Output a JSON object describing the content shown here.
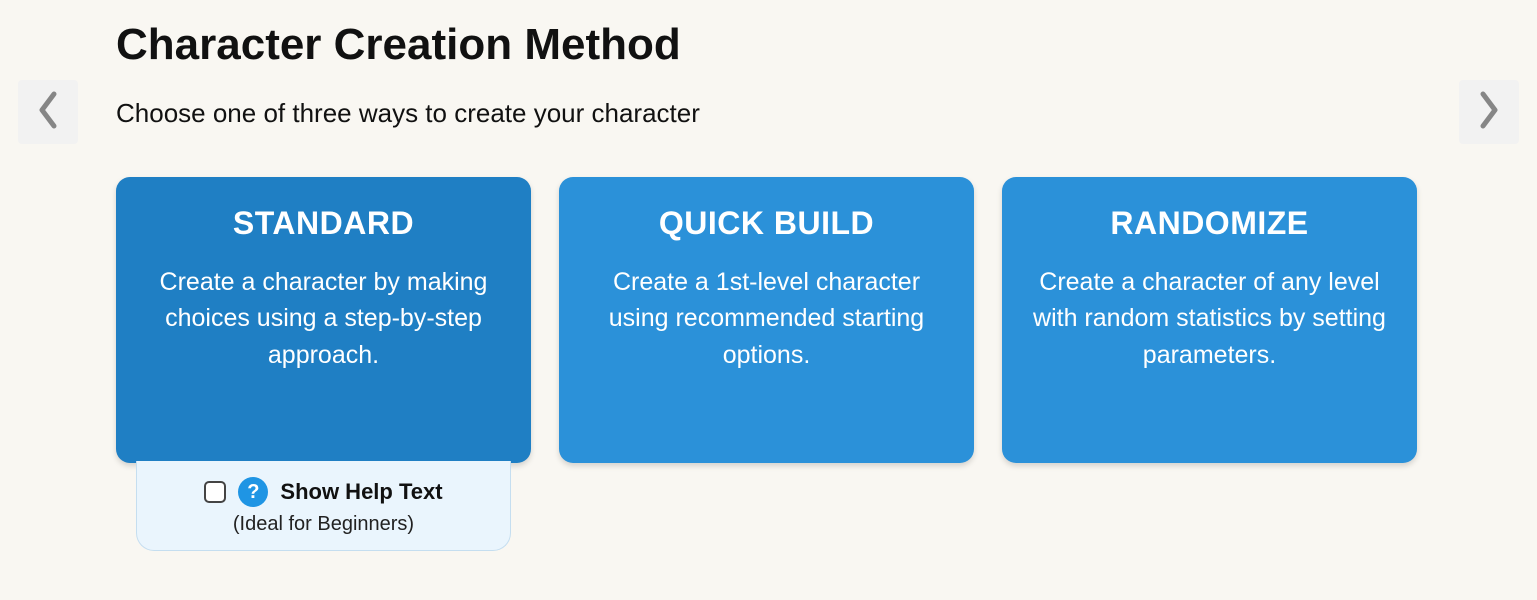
{
  "page": {
    "title": "Character Creation Method",
    "subtitle": "Choose one of three ways to create your character"
  },
  "colors": {
    "card_primary": "#2b91d9",
    "card_primary_selected": "#1f7fc4",
    "help_bg": "#eaf5fd",
    "help_border": "#c5def0",
    "help_icon_bg": "#1f95e4"
  },
  "methods": [
    {
      "id": "standard",
      "title": "STANDARD",
      "description": "Create a character by making choices using a step-by-step approach.",
      "selected": true,
      "help": {
        "label": "Show Help Text",
        "subtitle": "(Ideal for Beginners)",
        "checked": false
      }
    },
    {
      "id": "quick-build",
      "title": "QUICK BUILD",
      "description": "Create a 1st-level character using recommended starting options.",
      "selected": false
    },
    {
      "id": "randomize",
      "title": "RANDOMIZE",
      "description": "Create a character of any level with random statistics by setting parameters.",
      "selected": false
    }
  ]
}
